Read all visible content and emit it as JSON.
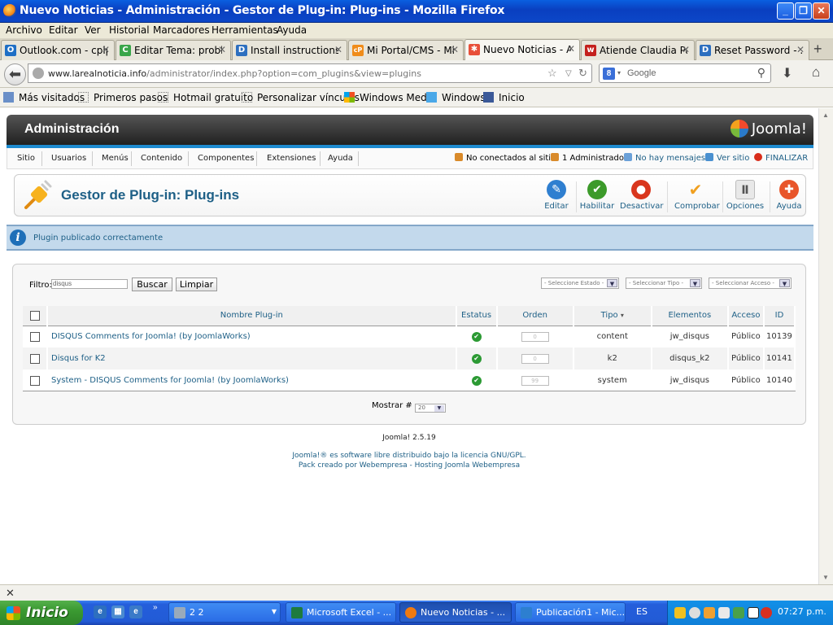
{
  "window": {
    "title": "Nuevo Noticias - Administración - Gestor de Plug-in: Plug-ins - Mozilla Firefox",
    "min": "_",
    "max": "❐",
    "close": "✕"
  },
  "menubar": [
    "Archivo",
    "Editar",
    "Ver",
    "Historial",
    "Marcadores",
    "Herramientas",
    "Ayuda"
  ],
  "tabs": [
    {
      "label": "Outlook.com - cplp...",
      "icon_color": "#1f6fc5",
      "icon_glyph": "O"
    },
    {
      "label": "Editar Tema: probl...",
      "icon_color": "#3aa64a",
      "icon_glyph": "C"
    },
    {
      "label": "Install instructions ...",
      "icon_color": "#2d6fbf",
      "icon_glyph": "D"
    },
    {
      "label": "Mi Portal/CMS - Mi...",
      "icon_color": "#f08c1a",
      "icon_glyph": "cP"
    },
    {
      "label": "Nuevo Noticias - A...",
      "icon_color": "#e8503a",
      "icon_glyph": "✱"
    },
    {
      "label": "Atiende Claudia Pa...",
      "icon_color": "#c4201c",
      "icon_glyph": "w"
    },
    {
      "label": "Reset Password - ...",
      "icon_color": "#2d6fbf",
      "icon_glyph": "D"
    }
  ],
  "tab_close": "✕",
  "new_tab": "+",
  "url": {
    "domain": "www.larealnoticia.info",
    "path": "/administrator/index.php?option=com_plugins&view=plugins"
  },
  "search": {
    "engine": "8",
    "placeholder": "Google"
  },
  "bookmarks": [
    "Más visitados",
    "Primeros pasos",
    "Hotmail gratuito",
    "Personalizar vínculos",
    "Windows Media",
    "Windows",
    "Inicio"
  ],
  "joomla": {
    "header_title": "Administración",
    "logo_text": "Joomla!",
    "menu": [
      "Sitio",
      "Usuarios",
      "Menús",
      "Contenido",
      "Componentes",
      "Extensiones",
      "Ayuda"
    ],
    "status": {
      "offline_users": "No conectados al sitio",
      "admins": "1 Administrador",
      "messages": "No hay mensajes",
      "view_site": "Ver sitio",
      "logout": "FINALIZAR"
    },
    "page_title": "Gestor de Plug-in: Plug-ins",
    "toolbar": [
      {
        "label": "Editar",
        "color": "#2f7fd0",
        "glyph": "✎"
      },
      {
        "label": "Habilitar",
        "color": "#3c9a2a",
        "glyph": "✔"
      },
      {
        "label": "Desactivar",
        "color": "#d9361d",
        "glyph": "●"
      },
      {
        "label": "Comprobar",
        "color": "#f0a020",
        "glyph": "✔"
      },
      {
        "label": "Opciones",
        "color": "#8a8a8a",
        "glyph": "Ⅱ"
      },
      {
        "label": "Ayuda",
        "color": "#e8552a",
        "glyph": "✚"
      }
    ],
    "message": "Plugin publicado correctamente",
    "filter": {
      "label": "Filtro:",
      "value": "disqus",
      "search_button": "Buscar",
      "clear_button": "Limpiar",
      "state_select": "- Seleccione Estado -",
      "type_select": "- Seleccionar Tipo -",
      "access_select": "- Seleccionar Acceso -"
    },
    "table": {
      "headers": [
        "Nombre Plug-in",
        "Estatus",
        "Orden",
        "Tipo",
        "Elementos",
        "Acceso",
        "ID"
      ],
      "rows": [
        {
          "name": "DISQUS Comments for Joomla! (by JoomlaWorks)",
          "order": "0",
          "type": "content",
          "element": "jw_disqus",
          "access": "Público",
          "id": "10139",
          "enabled": true
        },
        {
          "name": "Disqus for K2",
          "order": "0",
          "type": "k2",
          "element": "disqus_k2",
          "access": "Público",
          "id": "10141",
          "enabled": true
        },
        {
          "name": "System - DISQUS Comments for Joomla! (by JoomlaWorks)",
          "order": "99",
          "type": "system",
          "element": "jw_disqus",
          "access": "Público",
          "id": "10140",
          "enabled": true
        }
      ]
    },
    "pagination": {
      "label": "Mostrar #",
      "value": "20"
    },
    "footer": {
      "version": "Joomla! 2.5.19",
      "license": "Joomla!® es software libre distribuido bajo la licencia GNU/GPL.",
      "pack": "Pack creado por Webempresa - Hosting Joomla Webempresa"
    }
  },
  "taskbar": {
    "start": "Inicio",
    "tasks": [
      {
        "label": "2 2",
        "color": "#9ab"
      },
      {
        "label": "Microsoft Excel - ...",
        "color": "#1e7b3e"
      },
      {
        "label": "Nuevo Noticias - ...",
        "color": "#f07a10"
      },
      {
        "label": "Publicación1 - Mic...",
        "color": "#2d7fd0"
      }
    ],
    "language": "ES",
    "clock": "07:27 p.m."
  }
}
